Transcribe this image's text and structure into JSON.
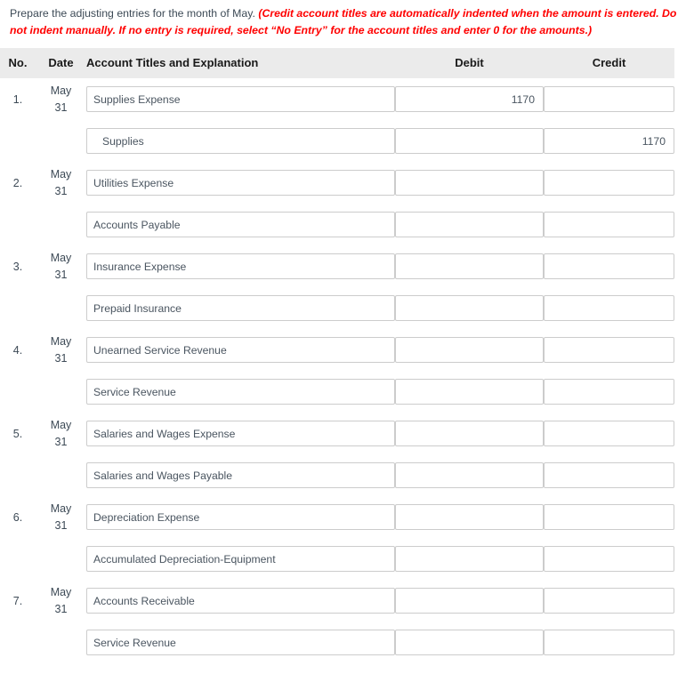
{
  "instructions": {
    "lead": "Prepare the adjusting entries for the month of May.",
    "note": "(Credit account titles are automatically indented when the amount is entered. Do not indent manually. If no entry is required, select “No Entry” for the account titles and enter 0 for the amounts.)"
  },
  "table": {
    "headers": {
      "no": "No.",
      "date": "Date",
      "account": "Account Titles and Explanation",
      "debit": "Debit",
      "credit": "Credit"
    },
    "rows": [
      {
        "no": "1.",
        "month": "May",
        "day": "31",
        "account": "Supplies Expense",
        "indent": false,
        "debit": "1170",
        "credit": ""
      },
      {
        "no": "",
        "month": "",
        "day": "",
        "account": "Supplies",
        "indent": true,
        "debit": "",
        "credit": "1170"
      },
      {
        "no": "2.",
        "month": "May",
        "day": "31",
        "account": "Utilities Expense",
        "indent": false,
        "debit": "",
        "credit": ""
      },
      {
        "no": "",
        "month": "",
        "day": "",
        "account": "Accounts Payable",
        "indent": false,
        "debit": "",
        "credit": ""
      },
      {
        "no": "3.",
        "month": "May",
        "day": "31",
        "account": "Insurance Expense",
        "indent": false,
        "debit": "",
        "credit": ""
      },
      {
        "no": "",
        "month": "",
        "day": "",
        "account": "Prepaid Insurance",
        "indent": false,
        "debit": "",
        "credit": ""
      },
      {
        "no": "4.",
        "month": "May",
        "day": "31",
        "account": "Unearned Service Revenue",
        "indent": false,
        "debit": "",
        "credit": ""
      },
      {
        "no": "",
        "month": "",
        "day": "",
        "account": "Service Revenue",
        "indent": false,
        "debit": "",
        "credit": ""
      },
      {
        "no": "5.",
        "month": "May",
        "day": "31",
        "account": "Salaries and Wages Expense",
        "indent": false,
        "debit": "",
        "credit": ""
      },
      {
        "no": "",
        "month": "",
        "day": "",
        "account": "Salaries and Wages Payable",
        "indent": false,
        "debit": "",
        "credit": ""
      },
      {
        "no": "6.",
        "month": "May",
        "day": "31",
        "account": "Depreciation Expense",
        "indent": false,
        "debit": "",
        "credit": ""
      },
      {
        "no": "",
        "month": "",
        "day": "",
        "account": "Accumulated Depreciation-Equipment",
        "indent": false,
        "debit": "",
        "credit": ""
      },
      {
        "no": "7.",
        "month": "May",
        "day": "31",
        "account": "Accounts Receivable",
        "indent": false,
        "debit": "",
        "credit": ""
      },
      {
        "no": "",
        "month": "",
        "day": "",
        "account": "Service Revenue",
        "indent": false,
        "debit": "",
        "credit": ""
      }
    ]
  }
}
